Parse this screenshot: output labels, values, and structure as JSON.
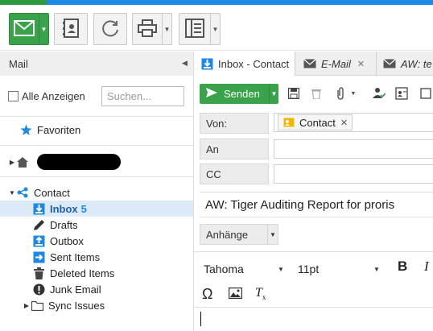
{
  "toolbar": {
    "buttons": [
      {
        "name": "mail",
        "icon": "envelope-icon"
      },
      {
        "name": "contacts",
        "icon": "address-book-icon"
      },
      {
        "name": "sync",
        "icon": "sync-icon"
      },
      {
        "name": "print",
        "icon": "printer-icon"
      },
      {
        "name": "layout",
        "icon": "layout-icon"
      }
    ]
  },
  "left": {
    "header": "Mail",
    "show_all_label": "Alle Anzeigen",
    "search_placeholder": "Suchen...",
    "favorites": "Favoriten",
    "account": "Contact",
    "folders": [
      {
        "label": "Inbox",
        "count": "5",
        "icon": "inbox-icon",
        "selected": true
      },
      {
        "label": "Drafts",
        "icon": "pencil-icon"
      },
      {
        "label": "Outbox",
        "icon": "outbox-icon"
      },
      {
        "label": "Sent Items",
        "icon": "sent-icon"
      },
      {
        "label": "Deleted Items",
        "icon": "trash-icon"
      },
      {
        "label": "Junk Email",
        "icon": "junk-icon"
      },
      {
        "label": "Sync Issues",
        "icon": "folder-icon"
      }
    ]
  },
  "tabs": [
    {
      "label": "Inbox - Contact",
      "icon": "inbox-icon"
    },
    {
      "label": "E-Mail",
      "icon": "envelope-icon",
      "closable": true
    },
    {
      "label": "AW: te",
      "icon": "envelope-icon"
    }
  ],
  "compose": {
    "send_label": "Senden",
    "from_label": "Von:",
    "from_chip": "Contact",
    "to_label": "An",
    "cc_label": "CC",
    "subject": "AW: Tiger Auditing Report for proris",
    "attachments_label": "Anhänge",
    "font": "Tahoma",
    "font_size": "11pt"
  },
  "colors": {
    "accent_green": "#3aa24a",
    "accent_blue": "#1e88e5",
    "selection": "#dce9f7"
  }
}
